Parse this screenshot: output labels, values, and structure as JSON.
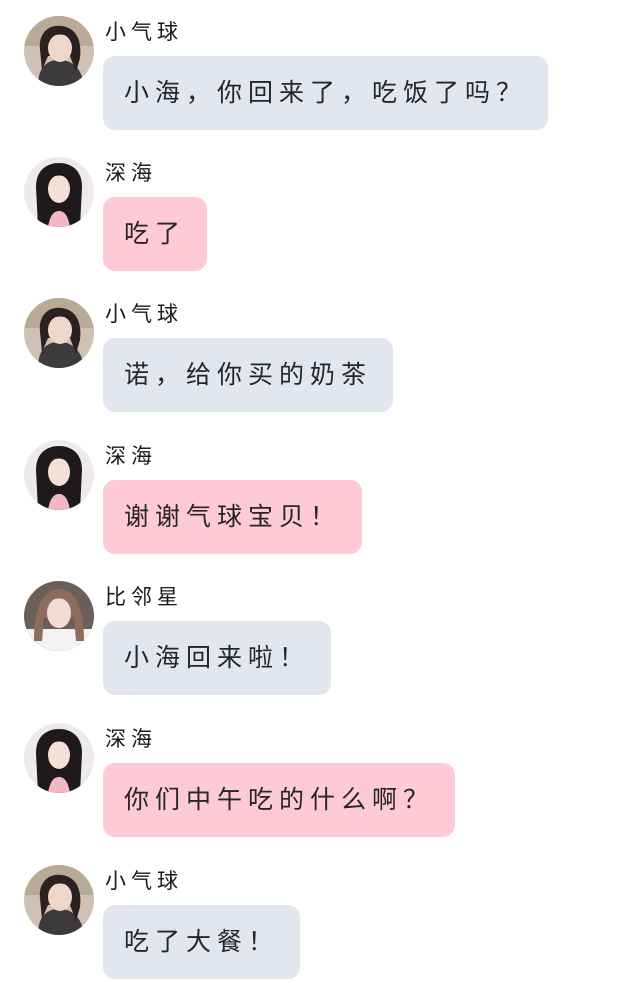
{
  "colors": {
    "left_bubble": "#e2e7ef",
    "pink_bubble": "#fdcad6",
    "background": "#ffffff",
    "text": "#262626"
  },
  "messages": [
    {
      "sender": "小气球",
      "text": "小海，你回来了，吃饭了吗？",
      "avatar": "avatar-xiaoqiqiu",
      "bubble": "gray"
    },
    {
      "sender": "深海",
      "text": "吃了",
      "avatar": "avatar-shenhai",
      "bubble": "pink"
    },
    {
      "sender": "小气球",
      "text": "诺，给你买的奶茶",
      "avatar": "avatar-xiaoqiqiu",
      "bubble": "gray"
    },
    {
      "sender": "深海",
      "text": "谢谢气球宝贝！",
      "avatar": "avatar-shenhai",
      "bubble": "pink"
    },
    {
      "sender": "比邻星",
      "text": "小海回来啦！",
      "avatar": "avatar-bilinxing",
      "bubble": "gray"
    },
    {
      "sender": "深海",
      "text": "你们中午吃的什么啊？",
      "avatar": "avatar-shenhai",
      "bubble": "pink"
    },
    {
      "sender": "小气球",
      "text": "吃了大餐！",
      "avatar": "avatar-xiaoqiqiu",
      "bubble": "gray"
    }
  ]
}
